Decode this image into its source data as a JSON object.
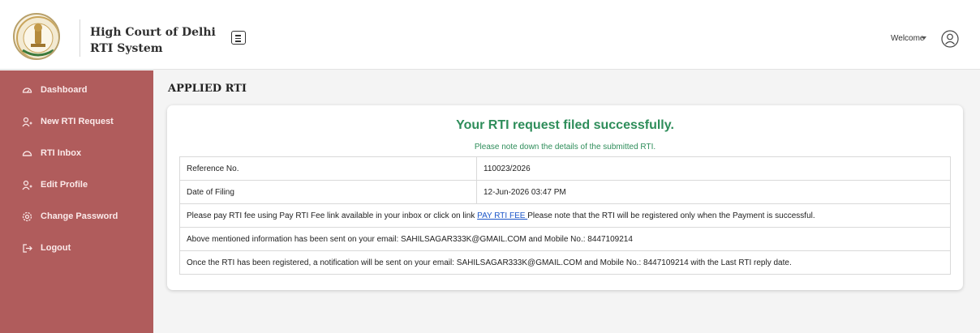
{
  "header": {
    "title_line1": "High Court of Delhi",
    "title_line2": "RTI System",
    "welcome_label": "Welcome",
    "logo_text": "HIGH COURT OF DELHI"
  },
  "sidebar": {
    "items": [
      {
        "label": "Dashboard",
        "icon": "dashboard-icon"
      },
      {
        "label": "New RTI Request",
        "icon": "add-user-icon"
      },
      {
        "label": "RTI Inbox",
        "icon": "inbox-icon"
      },
      {
        "label": "Edit Profile",
        "icon": "edit-profile-icon"
      },
      {
        "label": "Change Password",
        "icon": "gear-icon"
      },
      {
        "label": "Logout",
        "icon": "logout-icon"
      }
    ]
  },
  "main": {
    "page_title": "APPLIED RTI",
    "success_title": "Your RTI request filed successfully.",
    "success_subtitle": "Please note down the details of the submitted RTI.",
    "rows": {
      "ref_label": "Reference No.",
      "ref_value": "110023/2026",
      "date_label": "Date of Filing",
      "date_value": "12-Jun-2026 03:47 PM",
      "pay_text_before": "Please pay RTI fee using Pay RTI Fee link available in your inbox or click on link ",
      "pay_link": "PAY RTI FEE ",
      "pay_text_after": "Please note that the RTI will be registered only when the Payment is successful.",
      "info_sent": "Above mentioned information has been sent on your email: SAHILSAGAR333K@GMAIL.COM and Mobile No.: 8447109214",
      "notify_text": "Once the RTI has been registered, a notification will be sent on your email: SAHILSAGAR333K@GMAIL.COM and Mobile No.: 8447109214 with the Last RTI reply date."
    }
  },
  "colors": {
    "sidebar": "#b05c5c",
    "success": "#2e8d5a",
    "link": "#1a55c8"
  }
}
